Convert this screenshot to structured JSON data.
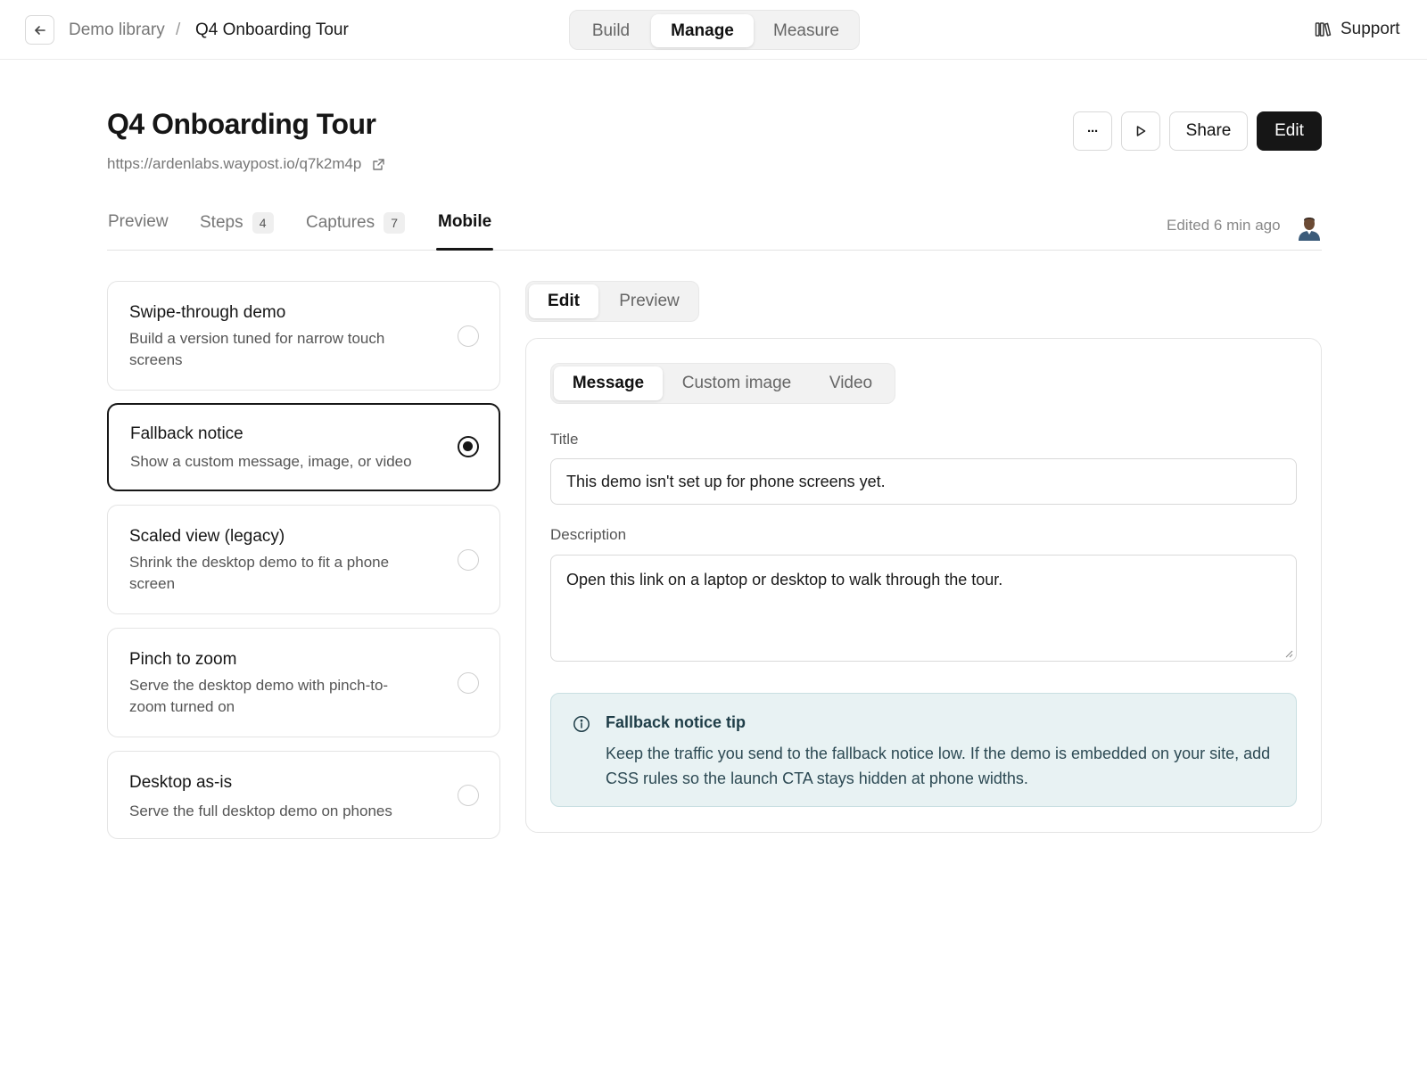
{
  "breadcrumb": {
    "library": "Demo library",
    "separator": "/",
    "current": "Q4 Onboarding Tour"
  },
  "modes": {
    "build": "Build",
    "manage": "Manage",
    "measure": "Measure",
    "active": "Manage"
  },
  "support_label": "Support",
  "header": {
    "title": "Q4 Onboarding Tour",
    "url": "https://ardenlabs.waypost.io/q7k2m4p",
    "more_label": "···",
    "share_label": "Share",
    "edit_label": "Edit"
  },
  "tabs": [
    {
      "label": "Preview",
      "count": null
    },
    {
      "label": "Steps",
      "count": "4"
    },
    {
      "label": "Captures",
      "count": "7"
    },
    {
      "label": "Mobile",
      "count": null
    }
  ],
  "active_tab": "Mobile",
  "edited_text": "Edited 6 min ago",
  "options": [
    {
      "title": "Swipe-through demo",
      "description": "Build a version tuned for narrow touch screens",
      "selected": false
    },
    {
      "title": "Fallback notice",
      "description": "Show a custom message, image, or video",
      "selected": true
    },
    {
      "title": "Scaled view (legacy)",
      "description": "Shrink the desktop demo to fit a phone screen",
      "selected": false
    },
    {
      "title": "Pinch to zoom",
      "description": "Serve the desktop demo with pinch-to-zoom turned on",
      "selected": false
    },
    {
      "title": "Desktop as-is",
      "description": "Serve the full desktop demo on phones",
      "selected": false
    }
  ],
  "editor_mode": {
    "edit": "Edit",
    "preview": "Preview",
    "active": "Edit"
  },
  "content_type": {
    "message": "Message",
    "custom_image": "Custom image",
    "video": "Video",
    "active": "Message"
  },
  "form": {
    "title_label": "Title",
    "title_value": "This demo isn't set up for phone screens yet.",
    "description_label": "Description",
    "description_value": "Open this link on a laptop or desktop to walk through the tour."
  },
  "tip": {
    "title": "Fallback notice tip",
    "body": "Keep the traffic you send to the fallback notice low. If the demo is embedded on your site, add CSS rules so the launch CTA stays hidden at phone widths."
  },
  "colors": {
    "primary": "#161616",
    "tip_background": "#e8f2f3",
    "tip_border": "#c9dfe2"
  }
}
